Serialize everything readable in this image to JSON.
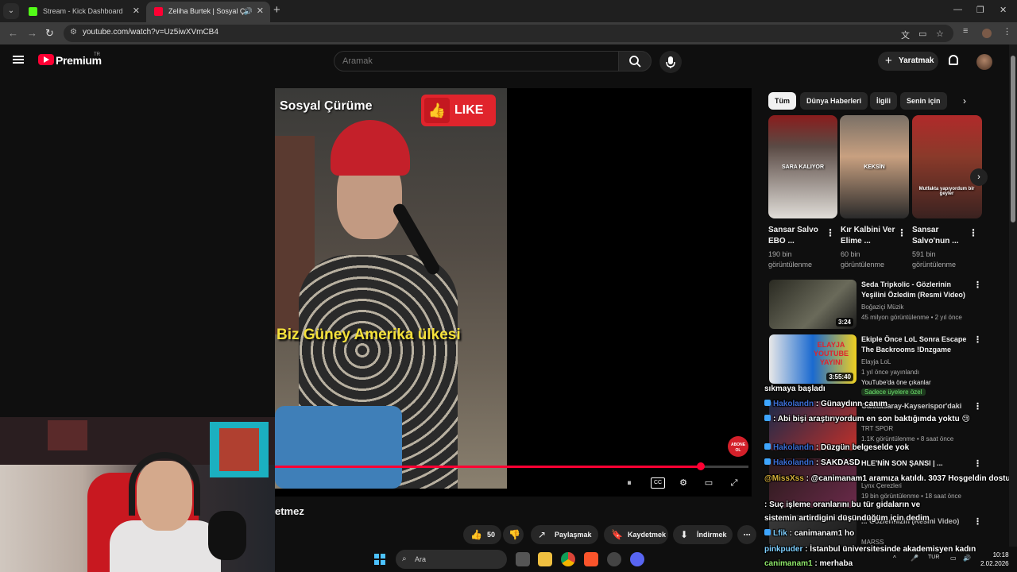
{
  "browser": {
    "tabs": [
      {
        "title": "Stream - Kick Dashboard",
        "active": false
      },
      {
        "title": "Zeliha Burtek | Sosyal Çürüme",
        "active": true
      }
    ],
    "url": "youtube.com/watch?v=Uz5iwXVmCB4"
  },
  "youtube": {
    "logo_text": "Premium",
    "country_code": "TR",
    "search_placeholder": "Aramak",
    "create_label": "Yaratmak"
  },
  "video": {
    "overlay_brand": "Sosyal Çürüme",
    "like_badge": "LIKE",
    "caption": "Biz Güney Amerika ülkesi",
    "subscribe_badge_line1": "ABONE",
    "subscribe_badge_line2": "OL",
    "progress_fraction": 0.9,
    "title_fragment": "etmez",
    "like_count": "50",
    "share_label": "Paylaşmak",
    "save_label": "Kaydetmek",
    "download_label": "İndirmek"
  },
  "sidebar": {
    "chips": [
      "Tüm",
      "Dünya Haberleri",
      "İlgili",
      "Senin için"
    ],
    "shorts": [
      {
        "title": "Sansar Salvo EBO ...",
        "views": "190 bin görüntülenme",
        "tag": "SARA KALIYOR"
      },
      {
        "title": "Kır Kalbini Ver Elime ...",
        "views": "60 bin görüntülenme",
        "tag": "KEKSİN"
      },
      {
        "title": "Sansar Salvo'nun ...",
        "views": "591 bin görüntülenme",
        "tag": "Mutfakta yapıyordum bir geyler"
      }
    ],
    "recommended": [
      {
        "title": "Seda Tripkolic - Gözlerinin Yeşilini Özledim (Resmi Video)",
        "channel": "Boğaziçi Müzik",
        "meta": "45 milyon görüntülenme • 2 yıl önce",
        "duration": "3:24"
      },
      {
        "title": "Ekiple Önce LoL Sonra Escape The Backrooms !Dnzgame",
        "channel": "Elayja LoL",
        "meta": "1 yıl önce yayınlandı",
        "extra": "YouTube'da öne çıkanlar",
        "members": "Sadece üyelere özel",
        "duration": "3:55:40",
        "thumb_text": "ELAYJA YOUTUBE YAYINI"
      },
      {
        "title": "Galatasaray-Kayserispor'daki",
        "channel": "TRT SPOR",
        "meta": "1.1K görüntülenme • 8 saat önce"
      },
      {
        "title": "HLE'NİN SON ŞANSI | ...",
        "channel": "Lynx Çerezleri",
        "meta": "19 bin görüntülenme • 18 saat önce"
      },
      {
        "title": "... Gözlerinizin (Resmi Video)",
        "channel": "MARSS",
        "meta": ""
      }
    ]
  },
  "chat": [
    {
      "user": "",
      "text": "sıkmaya başladı"
    },
    {
      "user": "Hakolandn",
      "text": ": Günaydınn canım"
    },
    {
      "user": "",
      "text": ": Abi bişi araştırıyordum en son baktığımda yoktu 😢"
    },
    {
      "user": "Hakolandn",
      "text": ": Düzgün belgeselde yok"
    },
    {
      "user": "Hakolandn",
      "text": ": SAKDASD"
    },
    {
      "user": "@MissXss",
      "text": ": @canimanam1 aramıza katıldı. 3037 Hoşgeldin dostum"
    },
    {
      "user": "",
      "text": ": Suç işleme oranlarını bu tür gidaların ve"
    },
    {
      "user": "",
      "text": "sistemin artirdigini düşündüğüm için dedim"
    },
    {
      "user": "Lfik",
      "text": ": canimanam1 ho"
    },
    {
      "user": "pinkpuder",
      "text": ": İstanbul üniversitesinde akademisyen kadın"
    },
    {
      "user": "canimanam1",
      "text": ": merhaba"
    }
  ],
  "taskbar": {
    "search_label": "Ara",
    "lang": "TUR",
    "time": "10:18",
    "date": "2.02.2026"
  },
  "colors": {
    "youtube_red": "#ff0033",
    "background": "#0f0f0f",
    "chip_bg": "#272727"
  }
}
